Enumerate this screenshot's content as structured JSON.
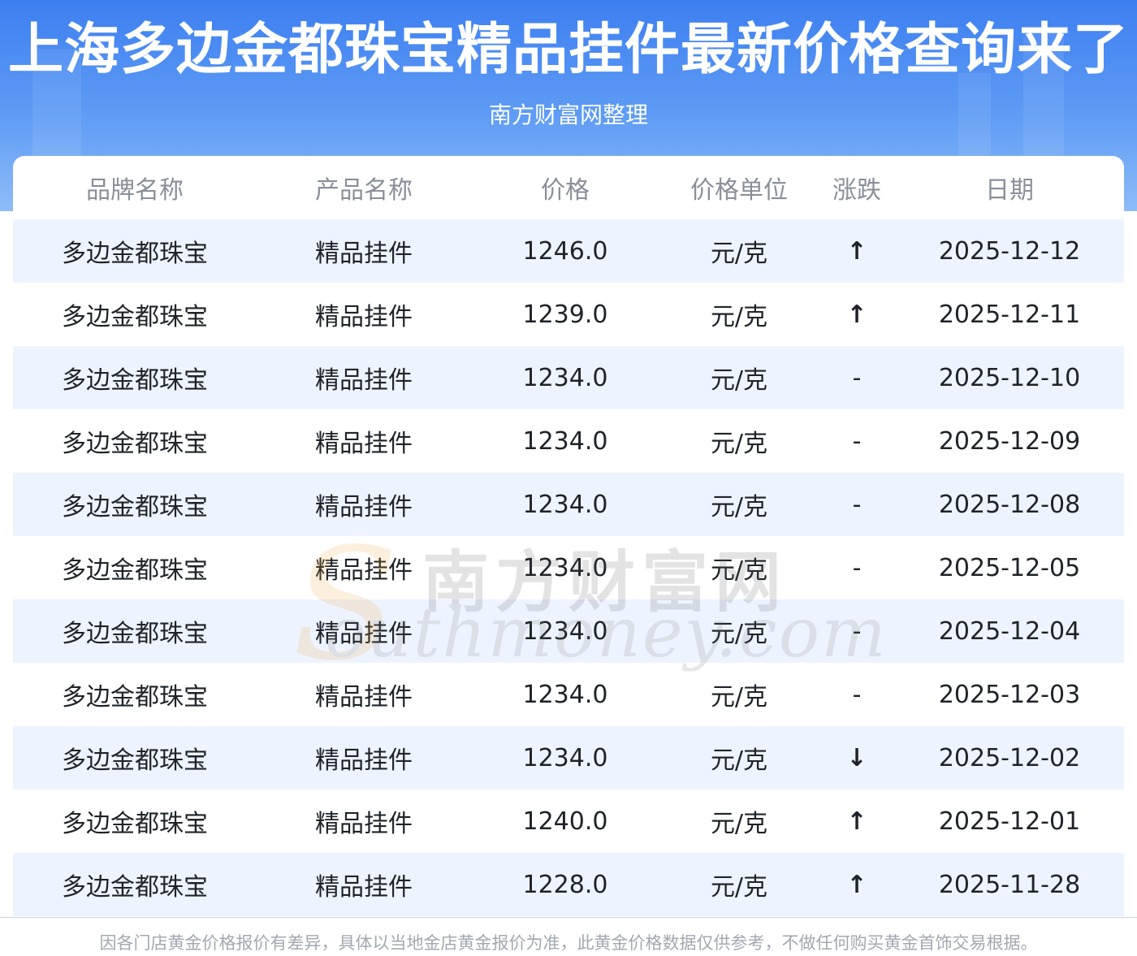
{
  "header": {
    "title": "上海多边金都珠宝精品挂件最新价格查询来了",
    "subtitle": "南方财富网整理"
  },
  "table": {
    "columns": [
      "品牌名称",
      "产品名称",
      "价格",
      "价格单位",
      "涨跌",
      "日期"
    ],
    "rows": [
      {
        "brand": "多边金都珠宝",
        "product": "精品挂件",
        "price": "1246.0",
        "unit": "元/克",
        "trend": "↑",
        "trend_dir": "up",
        "date": "2025-12-12"
      },
      {
        "brand": "多边金都珠宝",
        "product": "精品挂件",
        "price": "1239.0",
        "unit": "元/克",
        "trend": "↑",
        "trend_dir": "up",
        "date": "2025-12-11"
      },
      {
        "brand": "多边金都珠宝",
        "product": "精品挂件",
        "price": "1234.0",
        "unit": "元/克",
        "trend": "-",
        "trend_dir": "flat",
        "date": "2025-12-10"
      },
      {
        "brand": "多边金都珠宝",
        "product": "精品挂件",
        "price": "1234.0",
        "unit": "元/克",
        "trend": "-",
        "trend_dir": "flat",
        "date": "2025-12-09"
      },
      {
        "brand": "多边金都珠宝",
        "product": "精品挂件",
        "price": "1234.0",
        "unit": "元/克",
        "trend": "-",
        "trend_dir": "flat",
        "date": "2025-12-08"
      },
      {
        "brand": "多边金都珠宝",
        "product": "精品挂件",
        "price": "1234.0",
        "unit": "元/克",
        "trend": "-",
        "trend_dir": "flat",
        "date": "2025-12-05"
      },
      {
        "brand": "多边金都珠宝",
        "product": "精品挂件",
        "price": "1234.0",
        "unit": "元/克",
        "trend": "-",
        "trend_dir": "flat",
        "date": "2025-12-04"
      },
      {
        "brand": "多边金都珠宝",
        "product": "精品挂件",
        "price": "1234.0",
        "unit": "元/克",
        "trend": "-",
        "trend_dir": "flat",
        "date": "2025-12-03"
      },
      {
        "brand": "多边金都珠宝",
        "product": "精品挂件",
        "price": "1234.0",
        "unit": "元/克",
        "trend": "↓",
        "trend_dir": "down",
        "date": "2025-12-02"
      },
      {
        "brand": "多边金都珠宝",
        "product": "精品挂件",
        "price": "1240.0",
        "unit": "元/克",
        "trend": "↑",
        "trend_dir": "up",
        "date": "2025-12-01"
      },
      {
        "brand": "多边金都珠宝",
        "product": "精品挂件",
        "price": "1228.0",
        "unit": "元/克",
        "trend": "↑",
        "trend_dir": "up",
        "date": "2025-11-28"
      }
    ]
  },
  "watermark": {
    "cn": "南方财富网",
    "en": "outhmoney.com",
    "letter": "S"
  },
  "footer": {
    "disclaimer": "因各门店黄金价格报价有差异，具体以当地金店黄金报价为准，此黄金价格数据仅供参考，不做任何购买黄金首饰交易根据。"
  },
  "colors": {
    "header_blue": "#3d7ff0",
    "row_alt": "#eef4ff",
    "up": "#e60012",
    "down": "#1a8a1a"
  }
}
